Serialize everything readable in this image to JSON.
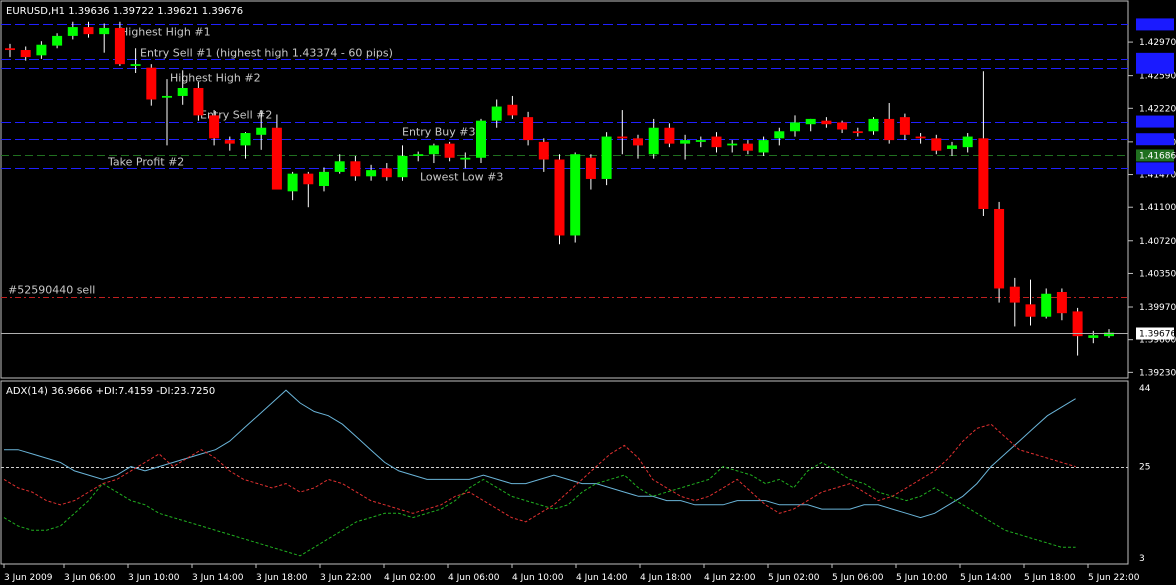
{
  "chart_data": [
    {
      "type": "candlestick",
      "symbol_header": "EURUSD,H1  1.39636 1.39722 1.39621 1.39676",
      "y_ticks": [
        "1.42970",
        "1.42590",
        "1.42220",
        "1.41840",
        "1.41470",
        "1.41100",
        "1.40720",
        "1.40350",
        "1.39970",
        "1.39600",
        "1.39230"
      ],
      "ylim": [
        1.392,
        1.4322
      ],
      "current_price_label": "1.39676",
      "current_price": 1.39676,
      "x_ticks": [
        "3 Jun 2009",
        "3 Jun 06:00",
        "3 Jun 10:00",
        "3 Jun 14:00",
        "3 Jun 18:00",
        "3 Jun 22:00",
        "4 Jun 02:00",
        "4 Jun 06:00",
        "4 Jun 10:00",
        "4 Jun 14:00",
        "4 Jun 18:00",
        "4 Jun 22:00",
        "5 Jun 02:00",
        "5 Jun 06:00",
        "5 Jun 10:00",
        "5 Jun 14:00",
        "5 Jun 18:00",
        "5 Jun 22:00"
      ],
      "levels": [
        {
          "name": "Highest High #1",
          "price": 1.4317,
          "color": "#2020ff",
          "label": "Highest High #1"
        },
        {
          "name": "Entry Sell #1",
          "price": 1.4278,
          "color": "#2020ff",
          "label": "Entry Sell #1 (highest high 1.43374 - 60 pips)"
        },
        {
          "name": "Highest High #2",
          "price": 1.4268,
          "color": "#2020ff",
          "label": "Highest High #2"
        },
        {
          "name": "Entry Sell #2",
          "price": 1.4207,
          "color": "#2020ff",
          "label": "Entry Sell #2"
        },
        {
          "name": "Entry Buy #3",
          "price": 1.4187,
          "color": "#2020ff",
          "label": "Entry Buy #3"
        },
        {
          "name": "Take Profit #2",
          "price": 1.41686,
          "color": "#207020",
          "label": "Take Profit #2"
        },
        {
          "name": "Lowest Low #3",
          "price": 1.4154,
          "color": "#2020ff",
          "label": "Lowest Low #3"
        },
        {
          "name": "#52590440 sell",
          "price": 1.4008,
          "color": "#c02020",
          "label": "#52590440 sell"
        }
      ],
      "axis_tags": [
        "",
        "",
        "",
        "",
        "",
        "1.41686",
        ""
      ],
      "candles": [
        {
          "o": 1.429,
          "h": 1.4295,
          "l": 1.428,
          "c": 1.4288
        },
        {
          "o": 1.4288,
          "h": 1.4292,
          "l": 1.4276,
          "c": 1.428
        },
        {
          "o": 1.4282,
          "h": 1.4298,
          "l": 1.4278,
          "c": 1.4294
        },
        {
          "o": 1.4293,
          "h": 1.4307,
          "l": 1.429,
          "c": 1.4304
        },
        {
          "o": 1.4304,
          "h": 1.432,
          "l": 1.43,
          "c": 1.4314
        },
        {
          "o": 1.4314,
          "h": 1.432,
          "l": 1.4302,
          "c": 1.4306
        },
        {
          "o": 1.4306,
          "h": 1.4318,
          "l": 1.4285,
          "c": 1.4313
        },
        {
          "o": 1.4313,
          "h": 1.432,
          "l": 1.427,
          "c": 1.4272
        },
        {
          "o": 1.427,
          "h": 1.429,
          "l": 1.4262,
          "c": 1.4272
        },
        {
          "o": 1.4268,
          "h": 1.4272,
          "l": 1.4225,
          "c": 1.4232
        },
        {
          "o": 1.4234,
          "h": 1.4255,
          "l": 1.418,
          "c": 1.4236
        },
        {
          "o": 1.4236,
          "h": 1.4265,
          "l": 1.4226,
          "c": 1.4245
        },
        {
          "o": 1.4245,
          "h": 1.4252,
          "l": 1.4208,
          "c": 1.4214
        },
        {
          "o": 1.4214,
          "h": 1.422,
          "l": 1.418,
          "c": 1.4188
        },
        {
          "o": 1.4186,
          "h": 1.419,
          "l": 1.4174,
          "c": 1.4182
        },
        {
          "o": 1.418,
          "h": 1.4195,
          "l": 1.4165,
          "c": 1.4194
        },
        {
          "o": 1.4192,
          "h": 1.422,
          "l": 1.4175,
          "c": 1.42
        },
        {
          "o": 1.42,
          "h": 1.4215,
          "l": 1.414,
          "c": 1.413
        },
        {
          "o": 1.4128,
          "h": 1.415,
          "l": 1.4118,
          "c": 1.4148
        },
        {
          "o": 1.4148,
          "h": 1.415,
          "l": 1.411,
          "c": 1.4136
        },
        {
          "o": 1.4134,
          "h": 1.4155,
          "l": 1.4128,
          "c": 1.415
        },
        {
          "o": 1.415,
          "h": 1.417,
          "l": 1.4148,
          "c": 1.4162
        },
        {
          "o": 1.4162,
          "h": 1.4168,
          "l": 1.414,
          "c": 1.4145
        },
        {
          "o": 1.4145,
          "h": 1.4158,
          "l": 1.414,
          "c": 1.4152
        },
        {
          "o": 1.4154,
          "h": 1.416,
          "l": 1.414,
          "c": 1.4144
        },
        {
          "o": 1.4144,
          "h": 1.418,
          "l": 1.414,
          "c": 1.4168
        },
        {
          "o": 1.4168,
          "h": 1.4173,
          "l": 1.4162,
          "c": 1.417
        },
        {
          "o": 1.417,
          "h": 1.4182,
          "l": 1.416,
          "c": 1.418
        },
        {
          "o": 1.4182,
          "h": 1.4184,
          "l": 1.4162,
          "c": 1.4166
        },
        {
          "o": 1.4164,
          "h": 1.4172,
          "l": 1.4154,
          "c": 1.4166
        },
        {
          "o": 1.4166,
          "h": 1.421,
          "l": 1.416,
          "c": 1.4208
        },
        {
          "o": 1.4208,
          "h": 1.4232,
          "l": 1.42,
          "c": 1.4224
        },
        {
          "o": 1.4226,
          "h": 1.4236,
          "l": 1.421,
          "c": 1.4214
        },
        {
          "o": 1.4212,
          "h": 1.4218,
          "l": 1.418,
          "c": 1.4186
        },
        {
          "o": 1.4184,
          "h": 1.4188,
          "l": 1.415,
          "c": 1.4164
        },
        {
          "o": 1.4164,
          "h": 1.417,
          "l": 1.4068,
          "c": 1.4078
        },
        {
          "o": 1.4078,
          "h": 1.4172,
          "l": 1.407,
          "c": 1.417
        },
        {
          "o": 1.4166,
          "h": 1.417,
          "l": 1.413,
          "c": 1.4142
        },
        {
          "o": 1.4142,
          "h": 1.4195,
          "l": 1.4135,
          "c": 1.419
        },
        {
          "o": 1.419,
          "h": 1.422,
          "l": 1.417,
          "c": 1.4188
        },
        {
          "o": 1.4188,
          "h": 1.4192,
          "l": 1.4165,
          "c": 1.418
        },
        {
          "o": 1.417,
          "h": 1.421,
          "l": 1.4165,
          "c": 1.42
        },
        {
          "o": 1.42,
          "h": 1.4205,
          "l": 1.4178,
          "c": 1.4182
        },
        {
          "o": 1.4182,
          "h": 1.4192,
          "l": 1.4164,
          "c": 1.4186
        },
        {
          "o": 1.4184,
          "h": 1.419,
          "l": 1.4178,
          "c": 1.4186
        },
        {
          "o": 1.419,
          "h": 1.4195,
          "l": 1.4172,
          "c": 1.4178
        },
        {
          "o": 1.418,
          "h": 1.4186,
          "l": 1.4172,
          "c": 1.4182
        },
        {
          "o": 1.4182,
          "h": 1.4186,
          "l": 1.417,
          "c": 1.4174
        },
        {
          "o": 1.4172,
          "h": 1.419,
          "l": 1.4168,
          "c": 1.4186
        },
        {
          "o": 1.4188,
          "h": 1.42,
          "l": 1.418,
          "c": 1.4196
        },
        {
          "o": 1.4196,
          "h": 1.4214,
          "l": 1.419,
          "c": 1.4206
        },
        {
          "o": 1.4204,
          "h": 1.421,
          "l": 1.4196,
          "c": 1.421
        },
        {
          "o": 1.4208,
          "h": 1.4212,
          "l": 1.42,
          "c": 1.4204
        },
        {
          "o": 1.4206,
          "h": 1.4208,
          "l": 1.4194,
          "c": 1.4198
        },
        {
          "o": 1.4196,
          "h": 1.42,
          "l": 1.419,
          "c": 1.4194
        },
        {
          "o": 1.4196,
          "h": 1.4212,
          "l": 1.4192,
          "c": 1.421
        },
        {
          "o": 1.421,
          "h": 1.4228,
          "l": 1.4182,
          "c": 1.4186
        },
        {
          "o": 1.4212,
          "h": 1.4216,
          "l": 1.4186,
          "c": 1.4192
        },
        {
          "o": 1.419,
          "h": 1.4194,
          "l": 1.4182,
          "c": 1.4188
        },
        {
          "o": 1.4188,
          "h": 1.4192,
          "l": 1.417,
          "c": 1.4174
        },
        {
          "o": 1.4176,
          "h": 1.4184,
          "l": 1.4168,
          "c": 1.418
        },
        {
          "o": 1.4178,
          "h": 1.4194,
          "l": 1.4172,
          "c": 1.419
        },
        {
          "o": 1.4188,
          "h": 1.4264,
          "l": 1.41,
          "c": 1.4108
        },
        {
          "o": 1.4108,
          "h": 1.4116,
          "l": 1.4002,
          "c": 1.4018
        },
        {
          "o": 1.402,
          "h": 1.403,
          "l": 1.3975,
          "c": 1.4002
        },
        {
          "o": 1.4,
          "h": 1.4028,
          "l": 1.3976,
          "c": 1.3986
        },
        {
          "o": 1.3986,
          "h": 1.4018,
          "l": 1.3984,
          "c": 1.4012
        },
        {
          "o": 1.4014,
          "h": 1.4018,
          "l": 1.3982,
          "c": 1.399
        },
        {
          "o": 1.3992,
          "h": 1.3996,
          "l": 1.3942,
          "c": 1.3964
        },
        {
          "o": 1.3962,
          "h": 1.397,
          "l": 1.3956,
          "c": 1.3965
        },
        {
          "o": 1.3964,
          "h": 1.3972,
          "l": 1.3962,
          "c": 1.3968
        }
      ]
    },
    {
      "type": "line",
      "title": "ADX(14) 36.9666 +DI:7.4159 -DI:23.7250",
      "y_ticks": [
        "44",
        "25",
        "3"
      ],
      "ylim": [
        3,
        44
      ],
      "level_line": 25,
      "series": [
        {
          "name": "ADX(14)",
          "color": "#6ab4d8",
          "values": [
            29,
            29,
            28,
            27,
            26,
            24,
            23,
            22,
            23,
            25,
            24,
            25,
            26,
            27,
            28,
            29,
            31,
            34,
            37,
            40,
            43,
            40,
            38,
            37,
            35,
            32,
            29,
            26,
            24,
            23,
            22,
            22,
            22,
            22,
            23,
            22,
            21,
            21,
            22,
            23,
            22,
            21,
            21,
            20,
            19,
            18,
            18,
            17,
            17,
            16,
            16,
            16,
            17,
            17,
            17,
            16,
            16,
            16,
            15,
            15,
            15,
            16,
            16,
            15,
            14,
            13,
            14,
            16,
            18,
            21,
            25,
            28,
            31,
            34,
            37,
            39,
            41
          ]
        },
        {
          "name": "+DI",
          "color": "#20b020",
          "values": [
            13,
            11,
            10,
            10,
            11,
            14,
            17,
            21,
            19,
            17,
            16,
            14,
            13,
            12,
            11,
            10,
            9,
            8,
            7,
            6,
            5,
            4,
            6,
            8,
            10,
            12,
            13,
            14,
            14,
            13,
            14,
            15,
            17,
            20,
            22,
            20,
            18,
            17,
            16,
            15,
            16,
            19,
            21,
            22,
            23,
            20,
            18,
            19,
            20,
            21,
            22,
            25,
            24,
            23,
            21,
            22,
            20,
            24,
            26,
            24,
            22,
            21,
            19,
            18,
            17,
            18,
            20,
            18,
            16,
            14,
            12,
            10,
            9,
            8,
            7,
            6,
            6
          ]
        },
        {
          "name": "-DI",
          "color": "#e03030",
          "values": [
            22,
            20,
            19,
            17,
            16,
            17,
            19,
            21,
            22,
            24,
            26,
            28,
            25,
            27,
            29,
            27,
            24,
            22,
            21,
            20,
            21,
            19,
            20,
            22,
            21,
            19,
            17,
            16,
            15,
            14,
            15,
            16,
            18,
            19,
            17,
            15,
            13,
            12,
            14,
            16,
            19,
            22,
            25,
            28,
            30,
            27,
            22,
            20,
            18,
            17,
            18,
            20,
            22,
            19,
            16,
            14,
            15,
            17,
            19,
            20,
            21,
            19,
            17,
            18,
            20,
            22,
            24,
            27,
            31,
            34,
            35,
            32,
            29,
            28,
            27,
            26,
            25
          ]
        }
      ]
    }
  ]
}
